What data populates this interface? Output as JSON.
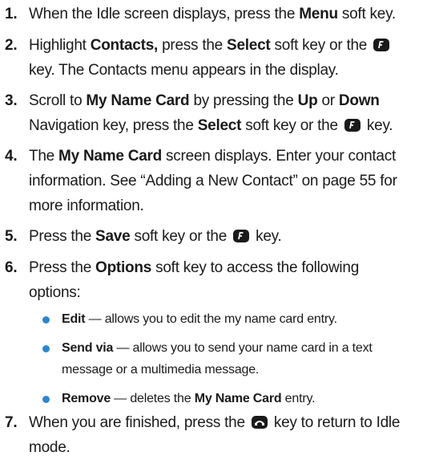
{
  "steps": [
    {
      "num": "1.",
      "t": [
        "When the Idle screen displays, press the ",
        "Menu",
        " soft key."
      ]
    },
    {
      "num": "2.",
      "t1": [
        "Highlight ",
        "Contacts,",
        " press the ",
        "Select",
        " soft key or the "
      ],
      "t1b": "key. The Contacts menu appears in the display."
    },
    {
      "num": "3.",
      "t1": [
        "Scroll to ",
        "My Name Card",
        " by pressing the ",
        "Up",
        " or ",
        "Down"
      ],
      "t2": [
        "Navigation key, press the ",
        "Select",
        " soft key or the "
      ],
      "t2b": " key."
    },
    {
      "num": "4.",
      "t1": [
        "The ",
        "My Name Card",
        " screen displays. Enter your contact"
      ],
      "t2": "information. See “Adding a New Contact” on page 55 for",
      "t3": "more information."
    },
    {
      "num": "5.",
      "t": [
        "Press the ",
        "Save",
        " soft key or the "
      ],
      "tb": " key."
    },
    {
      "num": "6.",
      "t1": [
        "Press the ",
        "Options",
        " soft key to access the following"
      ],
      "t2": "options:"
    },
    {
      "num": "7.",
      "t1": [
        "When you are finished, press the "
      ],
      "t1b": " key to return to Idle",
      "t2": "mode."
    }
  ],
  "bullets": [
    {
      "label": "Edit",
      "text": " — allows you to edit the my name card entry."
    },
    {
      "label": "Send via",
      "text": " — allows you to send your name card in a text",
      "text2": "message or a multimedia message."
    },
    {
      "label": "Remove",
      "text": " — deletes the ",
      "bold2": "My Name Card",
      "text3": " entry."
    }
  ],
  "icons": {
    "ok": "ok-key-icon",
    "end": "end-key-icon"
  },
  "colors": {
    "bullet": "#2b86d1"
  }
}
